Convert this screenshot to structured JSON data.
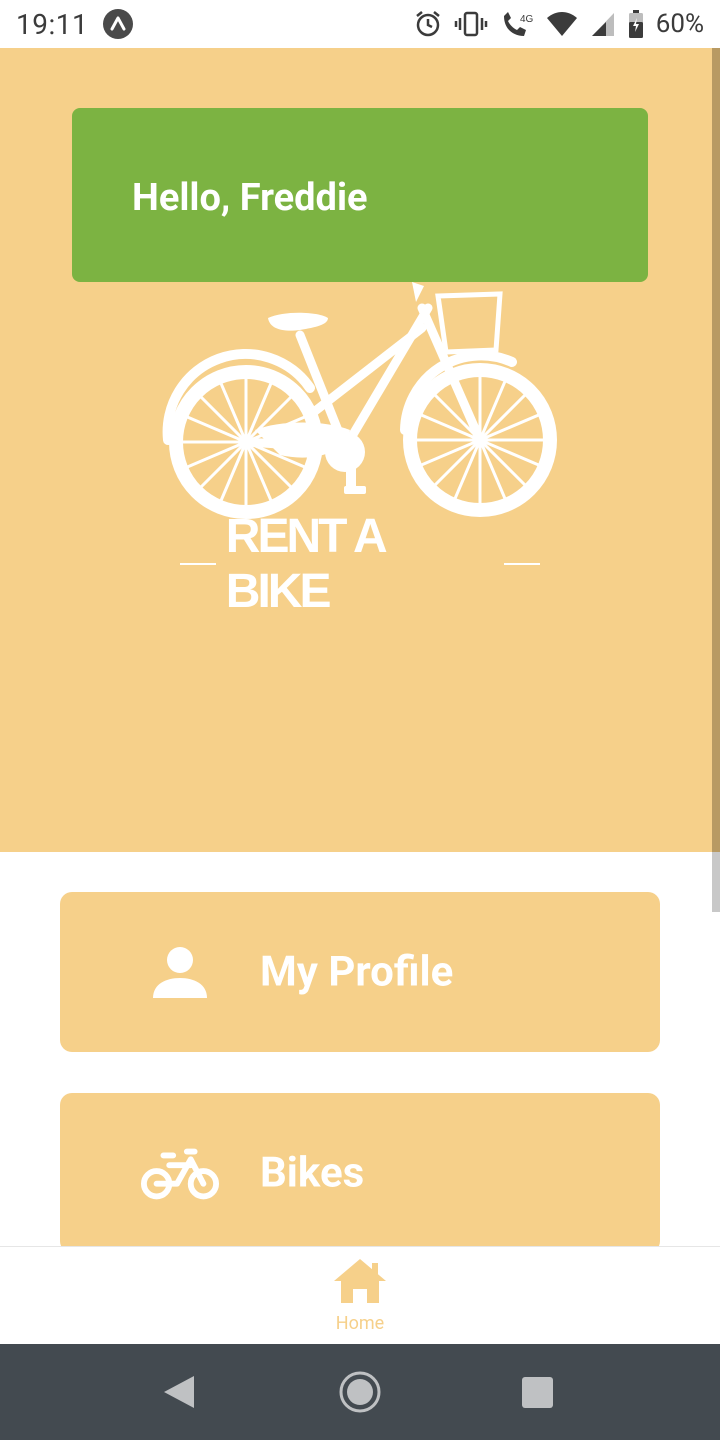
{
  "status_bar": {
    "time": "19:11",
    "battery": "60%",
    "icons": [
      "app-notification-icon",
      "alarm-icon",
      "vibrate-icon",
      "volte-call-icon",
      "wifi-icon",
      "signal-icon",
      "battery-charging-icon"
    ]
  },
  "hero": {
    "greeting": "Hello, Freddie",
    "logo_text": "RENT A BIKE",
    "logo_icon": "bicycle-with-basket-icon"
  },
  "menu": {
    "items": [
      {
        "label": "My Profile",
        "icon": "person-icon"
      },
      {
        "label": "Bikes",
        "icon": "bike-icon"
      }
    ]
  },
  "tab_bar": {
    "home_label": "Home",
    "home_icon": "home-icon"
  },
  "colors": {
    "accent": "#f6d08a",
    "greeting_bg": "#7cb342",
    "nav_bar": "#434a50"
  }
}
